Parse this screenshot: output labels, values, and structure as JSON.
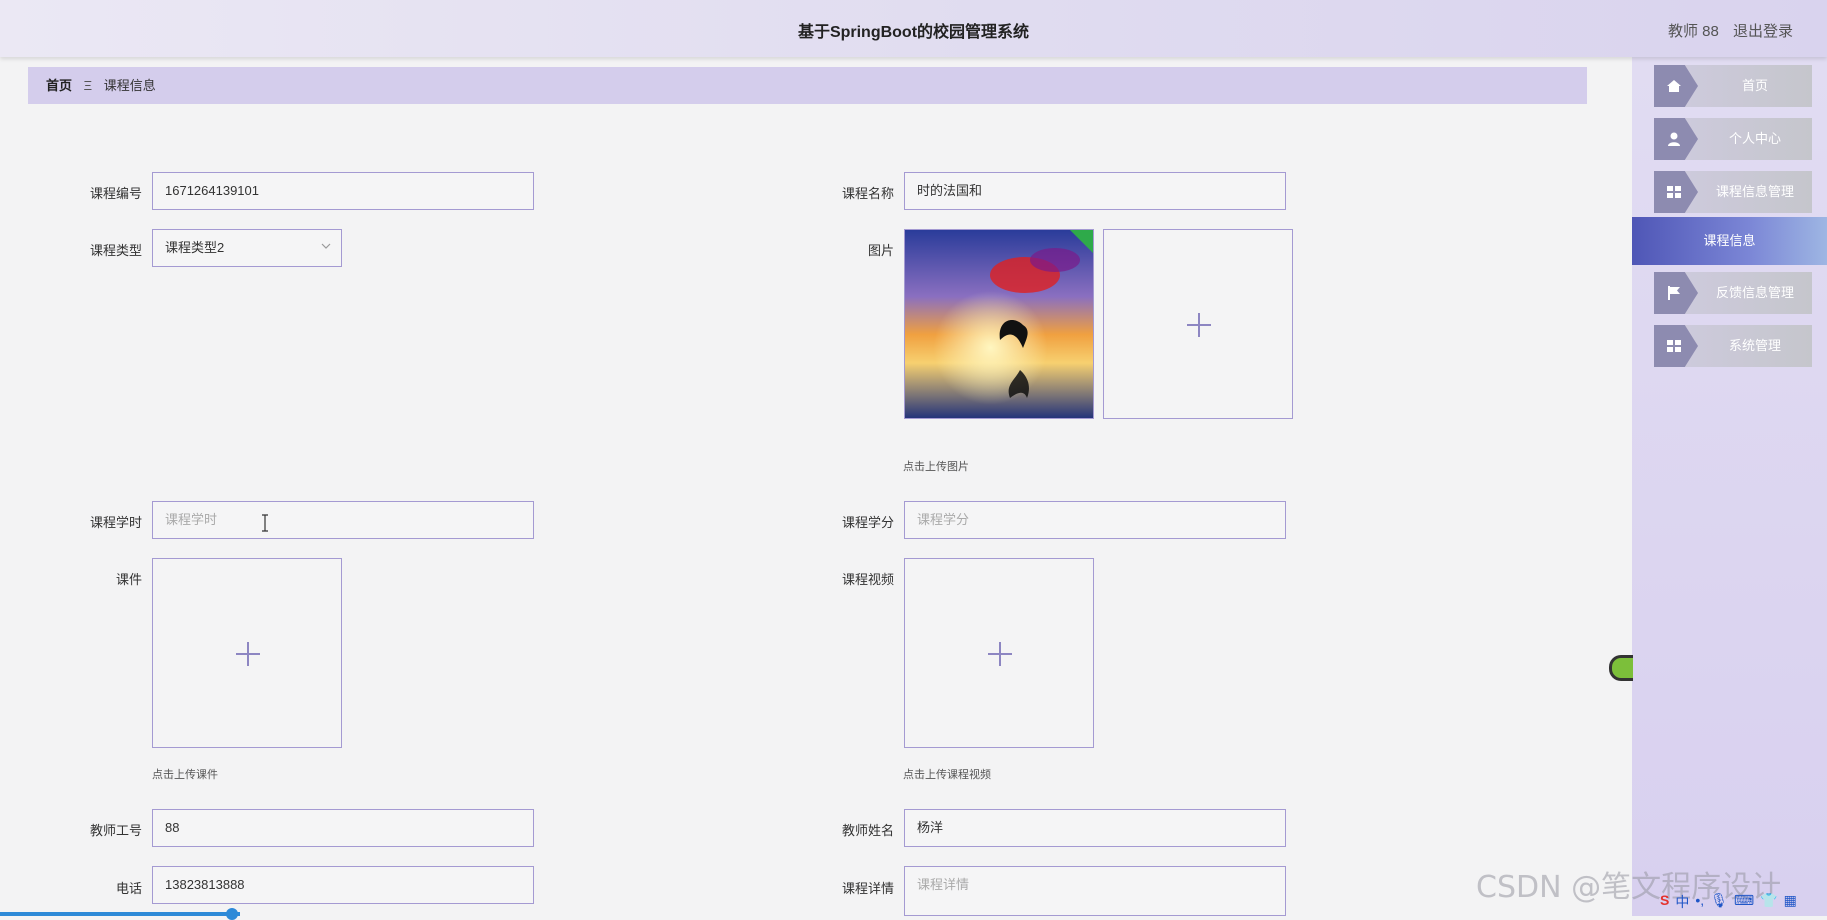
{
  "header": {
    "title": "基于SpringBoot的校园管理系统",
    "user_label": "教师 88",
    "logout_label": "退出登录"
  },
  "breadcrumb": {
    "home": "首页",
    "separator": "Ξ",
    "current": "课程信息"
  },
  "sidebar": {
    "items": [
      {
        "label": "首页",
        "icon": "home-icon"
      },
      {
        "label": "个人中心",
        "icon": "user-icon"
      },
      {
        "label": "课程信息管理",
        "icon": "grid-icon"
      },
      {
        "label": "课程信息",
        "icon": "",
        "active": true
      },
      {
        "label": "反馈信息管理",
        "icon": "flag-icon"
      },
      {
        "label": "系统管理",
        "icon": "grid-icon"
      }
    ]
  },
  "form": {
    "course_no": {
      "label": "课程编号",
      "value": "1671264139101"
    },
    "course_name": {
      "label": "课程名称",
      "value": "时的法国和"
    },
    "course_type": {
      "label": "课程类型",
      "value": "课程类型2"
    },
    "image": {
      "label": "图片",
      "hint": "点击上传图片"
    },
    "hours": {
      "label": "课程学时",
      "placeholder": "课程学时"
    },
    "credits": {
      "label": "课程学分",
      "placeholder": "课程学分"
    },
    "courseware": {
      "label": "课件",
      "hint": "点击上传课件"
    },
    "video": {
      "label": "课程视频",
      "hint": "点击上传课程视频"
    },
    "teacher_no": {
      "label": "教师工号",
      "value": "88"
    },
    "teacher_name": {
      "label": "教师姓名",
      "value": "杨洋"
    },
    "phone": {
      "label": "电话",
      "value": "13823813888"
    },
    "details": {
      "label": "课程详情",
      "placeholder": "课程详情"
    }
  },
  "overlay": {
    "watermark": "CSDN @笔文程序设计",
    "tray_ime": "中"
  },
  "colors": {
    "accent": "#a49ad2",
    "active_menu": "#4f56b6",
    "breadcrumb_bg": "#d4cdec"
  }
}
